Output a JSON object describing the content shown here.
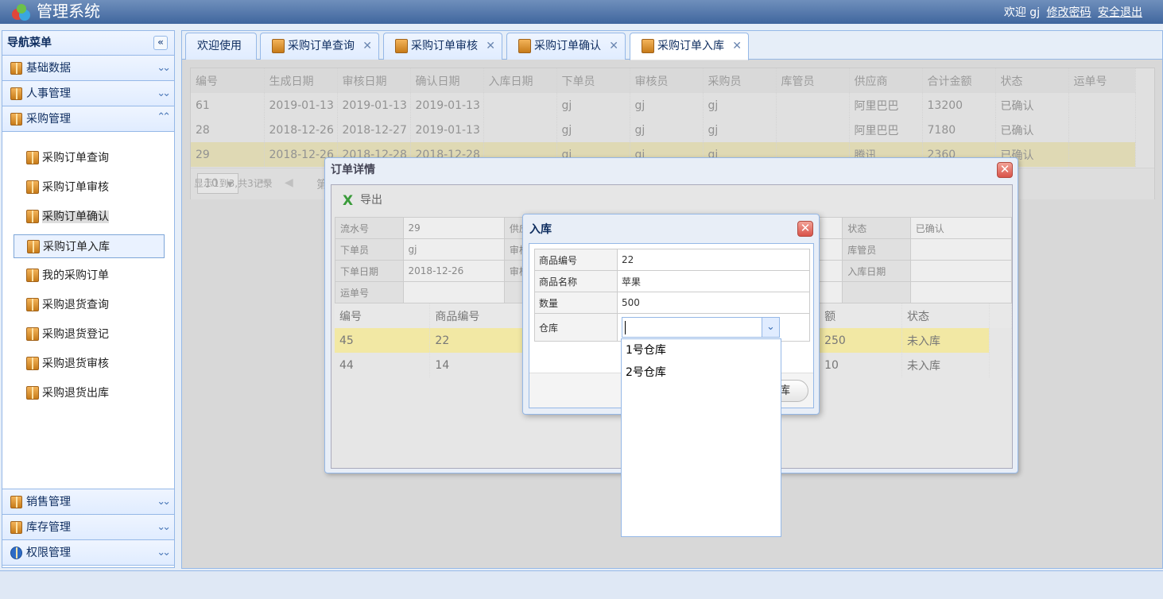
{
  "header": {
    "title": "管理系统",
    "welcome": "欢迎 gj",
    "change_password": "修改密码",
    "logout": "安全退出"
  },
  "sidebar": {
    "title": "导航菜单",
    "collapse_icon": "«",
    "groups": [
      {
        "label": "基础数据",
        "icon": "box-icon",
        "state": "collapsed"
      },
      {
        "label": "人事管理",
        "icon": "box-icon",
        "state": "collapsed"
      },
      {
        "label": "采购管理",
        "icon": "box-icon",
        "state": "expanded"
      },
      {
        "label": "销售管理",
        "icon": "box-icon",
        "state": "collapsed"
      },
      {
        "label": "库存管理",
        "icon": "box-icon",
        "state": "collapsed"
      },
      {
        "label": "权限管理",
        "icon": "help-icon",
        "state": "collapsed"
      }
    ],
    "items": [
      "采购订单查询",
      "采购订单审核",
      "采购订单确认",
      "采购订单入库",
      "我的采购订单",
      "采购退货查询",
      "采购退货登记",
      "采购退货审核",
      "采购退货出库"
    ],
    "selected_item": "采购订单入库"
  },
  "tabs": [
    "欢迎使用",
    "采购订单查询",
    "采购订单审核",
    "采购订单确认",
    "采购订单入库"
  ],
  "active_tab": "采购订单入库",
  "grid": {
    "columns": [
      "编号",
      "生成日期",
      "审核日期",
      "确认日期",
      "入库日期",
      "下单员",
      "审核员",
      "采购员",
      "库管员",
      "供应商",
      "合计金额",
      "状态",
      "运单号"
    ],
    "rows": [
      [
        "61",
        "2019-01-13",
        "2019-01-13",
        "2019-01-13",
        "",
        "gj",
        "gj",
        "gj",
        "",
        "阿里巴巴",
        "13200",
        "已确认",
        ""
      ],
      [
        "28",
        "2018-12-26",
        "2018-12-27",
        "2019-01-13",
        "",
        "gj",
        "gj",
        "gj",
        "",
        "阿里巴巴",
        "7180",
        "已确认",
        ""
      ],
      [
        "29",
        "2018-12-26",
        "2018-12-28",
        "2018-12-28",
        "",
        "gj",
        "gj",
        "gj",
        "",
        "腾讯",
        "2360",
        "已确认",
        ""
      ]
    ],
    "page_size": "10",
    "page_prefix": "第",
    "summary": "显示1到3,共3记录"
  },
  "detail": {
    "title": "订单详情",
    "export_label": "导出",
    "fields": [
      [
        "流水号",
        "29",
        "供应",
        "",
        "",
        "",
        "状态",
        "已确认"
      ],
      [
        "下单员",
        "gj",
        "审核",
        "",
        "",
        "",
        "库管员",
        ""
      ],
      [
        "下单日期",
        "2018-12-26",
        "审核",
        "",
        "",
        "",
        "入库日期",
        ""
      ],
      [
        "运单号",
        "",
        "",
        "",
        "",
        "",
        "",
        ""
      ]
    ],
    "columns": [
      "编号",
      "商品编号",
      "",
      "",
      "",
      "",
      "额",
      "状态"
    ],
    "rows": [
      [
        "45",
        "22",
        "",
        "",
        "",
        "",
        "250",
        "未入库"
      ],
      [
        "44",
        "14",
        "",
        "",
        "",
        "",
        "10",
        "未入库"
      ]
    ]
  },
  "dialog": {
    "title": "入库",
    "fields": [
      {
        "label": "商品编号",
        "value": "22"
      },
      {
        "label": "商品名称",
        "value": "苹果"
      },
      {
        "label": "数量",
        "value": "500"
      }
    ],
    "warehouse_label": "仓库",
    "warehouse_value": "",
    "options": [
      "1号仓库",
      "2号仓库"
    ],
    "button_label": "库"
  }
}
